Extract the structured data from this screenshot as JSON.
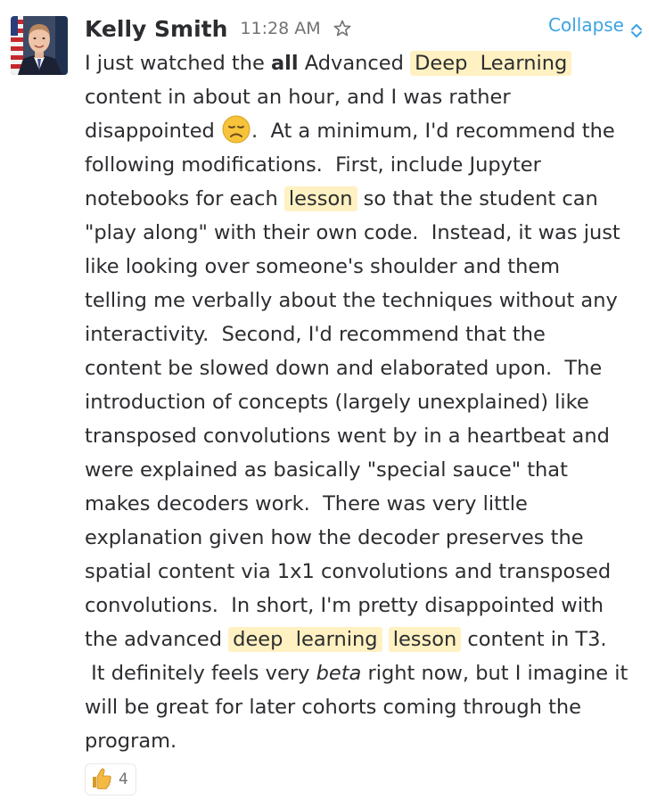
{
  "message": {
    "author": "Kelly Smith",
    "timestamp": "11:28 AM",
    "collapse_label": "Collapse",
    "lines": [
      [
        {
          "t": "I just watched the "
        },
        {
          "t": "all",
          "b": true
        },
        {
          "t": " Advanced "
        },
        {
          "t": "Deep  Learning",
          "hl": true
        }
      ],
      [
        {
          "t": "content in about an hour, and I was rather"
        }
      ],
      [
        {
          "t": "disappointed "
        },
        {
          "emoji": "disappointed-face"
        },
        {
          "t": ".  At a minimum, I'd recommend the"
        }
      ],
      [
        {
          "t": "following modifications.  First, include Jupyter"
        }
      ],
      [
        {
          "t": "notebooks for each "
        },
        {
          "t": "lesson",
          "hl": true
        },
        {
          "t": " so that the student can"
        }
      ],
      [
        {
          "t": "\"play along\" with their own code.  Instead, it was just"
        }
      ],
      [
        {
          "t": "like looking over someone's shoulder and them"
        }
      ],
      [
        {
          "t": "telling me verbally about the techniques without any"
        }
      ],
      [
        {
          "t": "interactivity.  Second, I'd recommend that the"
        }
      ],
      [
        {
          "t": "content be slowed down and elaborated upon.  The"
        }
      ],
      [
        {
          "t": "introduction of concepts (largely unexplained) like"
        }
      ],
      [
        {
          "t": "transposed convolutions went by in a heartbeat and"
        }
      ],
      [
        {
          "t": "were explained as basically \"special sauce\" that"
        }
      ],
      [
        {
          "t": "makes decoders work.  There was very little"
        }
      ],
      [
        {
          "t": "explanation given how the decoder preserves the"
        }
      ],
      [
        {
          "t": "spatial content via 1x1 convolutions and transposed"
        }
      ],
      [
        {
          "t": "convolutions.  In short, I'm pretty disappointed with"
        }
      ],
      [
        {
          "t": "the advanced "
        },
        {
          "t": "deep  learning",
          "hl": true
        },
        {
          "t": " "
        },
        {
          "t": "lesson",
          "hl": true
        },
        {
          "t": " content in T3."
        }
      ],
      [
        {
          "t": " It definitely feels very "
        },
        {
          "t": "beta",
          "i": true
        },
        {
          "t": " right now, but I imagine it"
        }
      ],
      [
        {
          "t": "will be great for later cohorts coming through the"
        }
      ],
      [
        {
          "t": "program."
        }
      ]
    ],
    "reaction": {
      "emoji": "thumbs-up",
      "count": "4"
    }
  },
  "colors": {
    "link": "#3aa3e3",
    "highlight": "#fff1c2",
    "text": "#2c2d30",
    "muted": "#717274"
  }
}
